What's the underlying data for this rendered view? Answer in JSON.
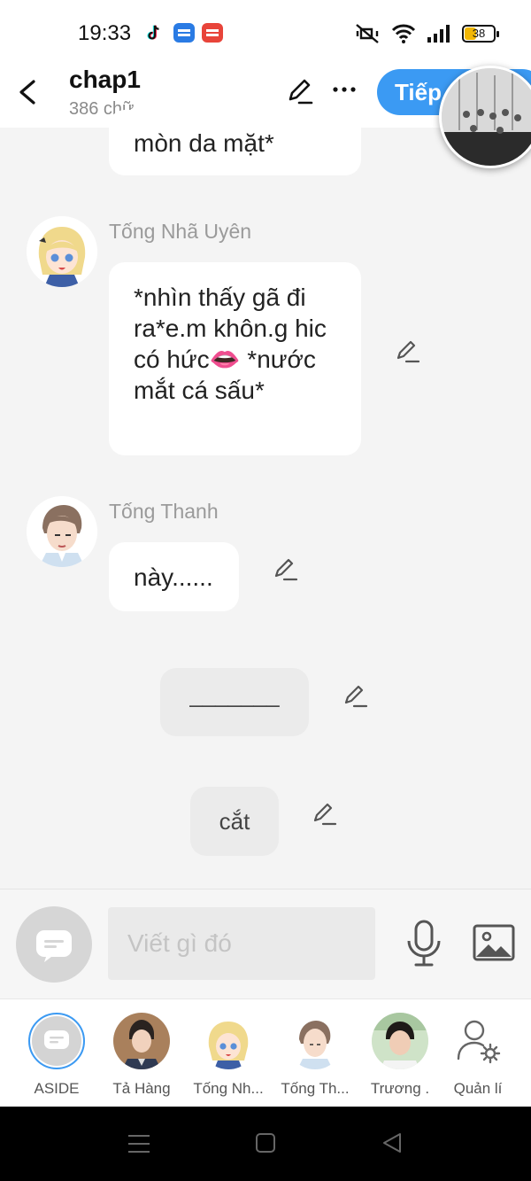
{
  "status": {
    "time": "19:33",
    "battery": "38"
  },
  "header": {
    "title": "chap1",
    "word_count": "386 chữ",
    "next_label": "Tiếp"
  },
  "messages": [
    {
      "type": "speech",
      "text": "mòn da mặt*"
    },
    {
      "type": "speech",
      "speaker": "Tống Nhã Uyên",
      "text": "*nhìn thấy gã đi ra*e.m khôn.g hic có hức👄 *nước mắt cá sấu*"
    },
    {
      "type": "speech",
      "speaker": "Tống Thanh",
      "text": "này......"
    },
    {
      "type": "narration",
      "text": "_______"
    },
    {
      "type": "narration",
      "text": "cắt"
    }
  ],
  "composer": {
    "placeholder": "Viết gì đó"
  },
  "characters": [
    {
      "label": "ASIDE"
    },
    {
      "label": "Tả Hàng"
    },
    {
      "label": "Tống Nh..."
    },
    {
      "label": "Tống Th..."
    },
    {
      "label": "Trương ."
    },
    {
      "label": "Quản lí"
    }
  ],
  "colors": {
    "accent": "#3b9af3",
    "background": "#f4f4f4",
    "bubble": "#ffffff",
    "narration": "#ebebeb"
  }
}
